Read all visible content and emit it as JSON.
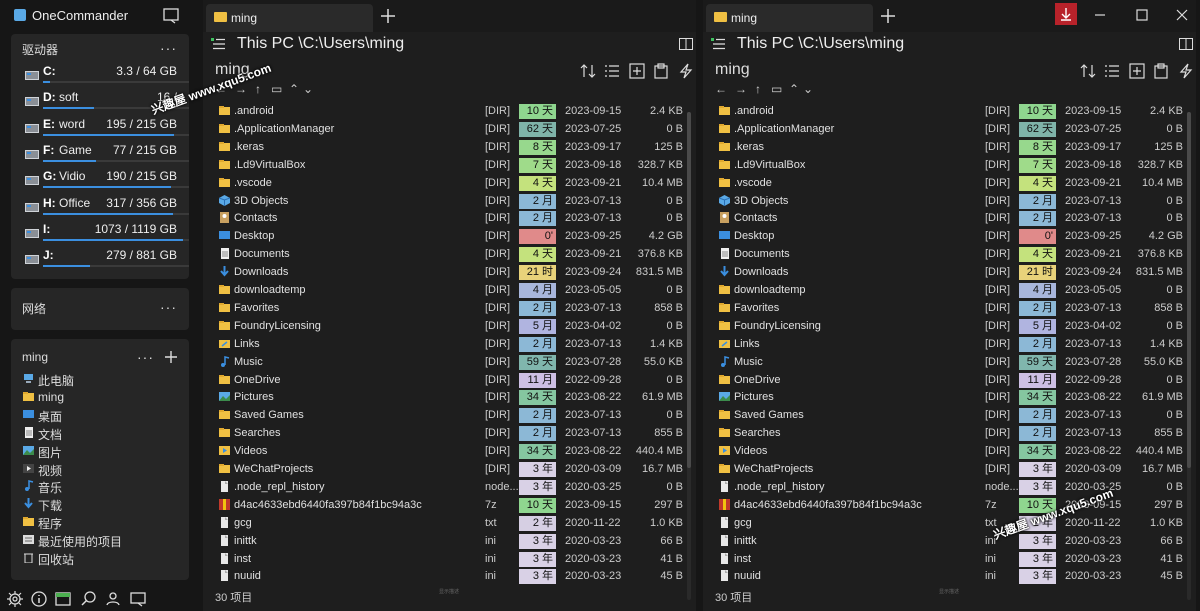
{
  "app": {
    "name": "OneCommander"
  },
  "sidebar": {
    "drives_title": "驱动器",
    "more": "···",
    "drives": [
      {
        "letter": "C:",
        "name": "",
        "size": "3.3 / 64 GB",
        "used": 0.05
      },
      {
        "letter": "D:",
        "name": "soft",
        "size": "16 /",
        "used": 0.35
      },
      {
        "letter": "E:",
        "name": "word",
        "size": "195 / 215 GB",
        "used": 0.9
      },
      {
        "letter": "F:",
        "name": "Game",
        "size": "77 / 215 GB",
        "used": 0.36
      },
      {
        "letter": "G:",
        "name": "Vidio",
        "size": "190 / 215 GB",
        "used": 0.88
      },
      {
        "letter": "H:",
        "name": "Office",
        "size": "317 / 356 GB",
        "used": 0.89
      },
      {
        "letter": "I:",
        "name": "",
        "size": "1073 / 1119 GB",
        "used": 0.96
      },
      {
        "letter": "J:",
        "name": "",
        "size": "279 / 881 GB",
        "used": 0.32
      }
    ],
    "network_title": "网络",
    "favorites_title": "ming",
    "favorites": [
      {
        "label": "此电脑",
        "icon": "pc-icon"
      },
      {
        "label": "ming",
        "icon": "folder-icon"
      },
      {
        "label": "桌面",
        "icon": "desktop-icon"
      },
      {
        "label": "文档",
        "icon": "document-icon"
      },
      {
        "label": "图片",
        "icon": "picture-icon"
      },
      {
        "label": "视频",
        "icon": "video-icon"
      },
      {
        "label": "音乐",
        "icon": "music-icon"
      },
      {
        "label": "下载",
        "icon": "download-icon"
      },
      {
        "label": "程序",
        "icon": "folder-icon"
      },
      {
        "label": "最近使用的项目",
        "icon": "recent-icon"
      },
      {
        "label": "回收站",
        "icon": "recycle-bin-icon"
      }
    ]
  },
  "panes": [
    {
      "tab": "ming",
      "path": "This PC \\C:\\Users\\ming",
      "folder": "ming",
      "status": "30 项目",
      "grip": "显示描述"
    },
    {
      "tab": "ming",
      "path": "This PC \\C:\\Users\\ming",
      "folder": "ming",
      "status": "30 项目",
      "grip": "显示描述"
    }
  ],
  "files": [
    {
      "name": ".android",
      "type": "[DIR]",
      "age": "10 天",
      "age_color": "#8fd68f",
      "date": "2023-09-15",
      "size": "2.4 KB",
      "icon": "folder"
    },
    {
      "name": ".ApplicationManager",
      "type": "[DIR]",
      "age": "62 天",
      "age_color": "#7fb3a9",
      "date": "2023-07-25",
      "size": "0 B",
      "icon": "folder"
    },
    {
      "name": ".keras",
      "type": "[DIR]",
      "age": "8 天",
      "age_color": "#97d88d",
      "date": "2023-09-17",
      "size": "125 B",
      "icon": "folder"
    },
    {
      "name": ".Ld9VirtualBox",
      "type": "[DIR]",
      "age": "7 天",
      "age_color": "#9fdb8a",
      "date": "2023-09-18",
      "size": "328.7 KB",
      "icon": "folder"
    },
    {
      "name": ".vscode",
      "type": "[DIR]",
      "age": "4 天",
      "age_color": "#c4e27d",
      "date": "2023-09-21",
      "size": "10.4 MB",
      "icon": "folder"
    },
    {
      "name": "3D Objects",
      "type": "[DIR]",
      "age": "2 月",
      "age_color": "#8cb8d6",
      "date": "2023-07-13",
      "size": "0 B",
      "icon": "cube"
    },
    {
      "name": "Contacts",
      "type": "[DIR]",
      "age": "2 月",
      "age_color": "#8cb8d6",
      "date": "2023-07-13",
      "size": "0 B",
      "icon": "contacts"
    },
    {
      "name": "Desktop",
      "type": "[DIR]",
      "age": "0'",
      "age_color": "#e08a8a",
      "date": "2023-09-25",
      "size": "4.2 GB",
      "icon": "desktop"
    },
    {
      "name": "Documents",
      "type": "[DIR]",
      "age": "4 天",
      "age_color": "#c4e27d",
      "date": "2023-09-21",
      "size": "376.8 KB",
      "icon": "document"
    },
    {
      "name": "Downloads",
      "type": "[DIR]",
      "age": "21 时",
      "age_color": "#e8d27a",
      "date": "2023-09-24",
      "size": "831.5 MB",
      "icon": "download"
    },
    {
      "name": "downloadtemp",
      "type": "[DIR]",
      "age": "4 月",
      "age_color": "#a8b6dc",
      "date": "2023-05-05",
      "size": "0 B",
      "icon": "folder"
    },
    {
      "name": "Favorites",
      "type": "[DIR]",
      "age": "2 月",
      "age_color": "#8cb8d6",
      "date": "2023-07-13",
      "size": "858 B",
      "icon": "folder"
    },
    {
      "name": "FoundryLicensing",
      "type": "[DIR]",
      "age": "5 月",
      "age_color": "#b0b4e0",
      "date": "2023-04-02",
      "size": "0 B",
      "icon": "folder"
    },
    {
      "name": "Links",
      "type": "[DIR]",
      "age": "2 月",
      "age_color": "#8cb8d6",
      "date": "2023-07-13",
      "size": "1.4 KB",
      "icon": "link"
    },
    {
      "name": "Music",
      "type": "[DIR]",
      "age": "59 天",
      "age_color": "#80b6ad",
      "date": "2023-07-28",
      "size": "55.0 KB",
      "icon": "music"
    },
    {
      "name": "OneDrive",
      "type": "[DIR]",
      "age": "11 月",
      "age_color": "#cdbfe4",
      "date": "2022-09-28",
      "size": "0 B",
      "icon": "folder"
    },
    {
      "name": "Pictures",
      "type": "[DIR]",
      "age": "34 天",
      "age_color": "#85c6a0",
      "date": "2023-08-22",
      "size": "61.9 MB",
      "icon": "picture"
    },
    {
      "name": "Saved Games",
      "type": "[DIR]",
      "age": "2 月",
      "age_color": "#8cb8d6",
      "date": "2023-07-13",
      "size": "0 B",
      "icon": "folder"
    },
    {
      "name": "Searches",
      "type": "[DIR]",
      "age": "2 月",
      "age_color": "#8cb8d6",
      "date": "2023-07-13",
      "size": "855 B",
      "icon": "folder"
    },
    {
      "name": "Videos",
      "type": "[DIR]",
      "age": "34 天",
      "age_color": "#85c6a0",
      "date": "2023-08-22",
      "size": "440.4 MB",
      "icon": "video"
    },
    {
      "name": "WeChatProjects",
      "type": "[DIR]",
      "age": "3 年",
      "age_color": "#d9d1e6",
      "date": "2020-03-09",
      "size": "16.7 MB",
      "icon": "folder"
    },
    {
      "name": ".node_repl_history",
      "type": "node...",
      "age": "3 年",
      "age_color": "#d9d1e6",
      "date": "2020-03-25",
      "size": "0 B",
      "icon": "file"
    },
    {
      "name": "d4ac4633ebd6440fa397b84f1bc94a3c",
      "type": "7z",
      "age": "10 天",
      "age_color": "#8fd68f",
      "date": "2023-09-15",
      "size": "297 B",
      "icon": "archive"
    },
    {
      "name": "gcg",
      "type": "txt",
      "age": "2 年",
      "age_color": "#d6cfe3",
      "date": "2020-11-22",
      "size": "1.0 KB",
      "icon": "file"
    },
    {
      "name": "inittk",
      "type": "ini",
      "age": "3 年",
      "age_color": "#d9d1e6",
      "date": "2020-03-23",
      "size": "66 B",
      "icon": "file"
    },
    {
      "name": "inst",
      "type": "ini",
      "age": "3 年",
      "age_color": "#d9d1e6",
      "date": "2020-03-23",
      "size": "41 B",
      "icon": "file"
    },
    {
      "name": "nuuid",
      "type": "ini",
      "age": "3 年",
      "age_color": "#d9d1e6",
      "date": "2020-03-23",
      "size": "45 B",
      "icon": "file"
    }
  ],
  "watermarks": [
    "兴趣屋 www.xqu5.com",
    "兴趣屋 www.xqu5.com"
  ],
  "colors": {
    "accent": "#3b8fe0",
    "folder": "#f0c043",
    "download_btn": "#b8222a"
  }
}
